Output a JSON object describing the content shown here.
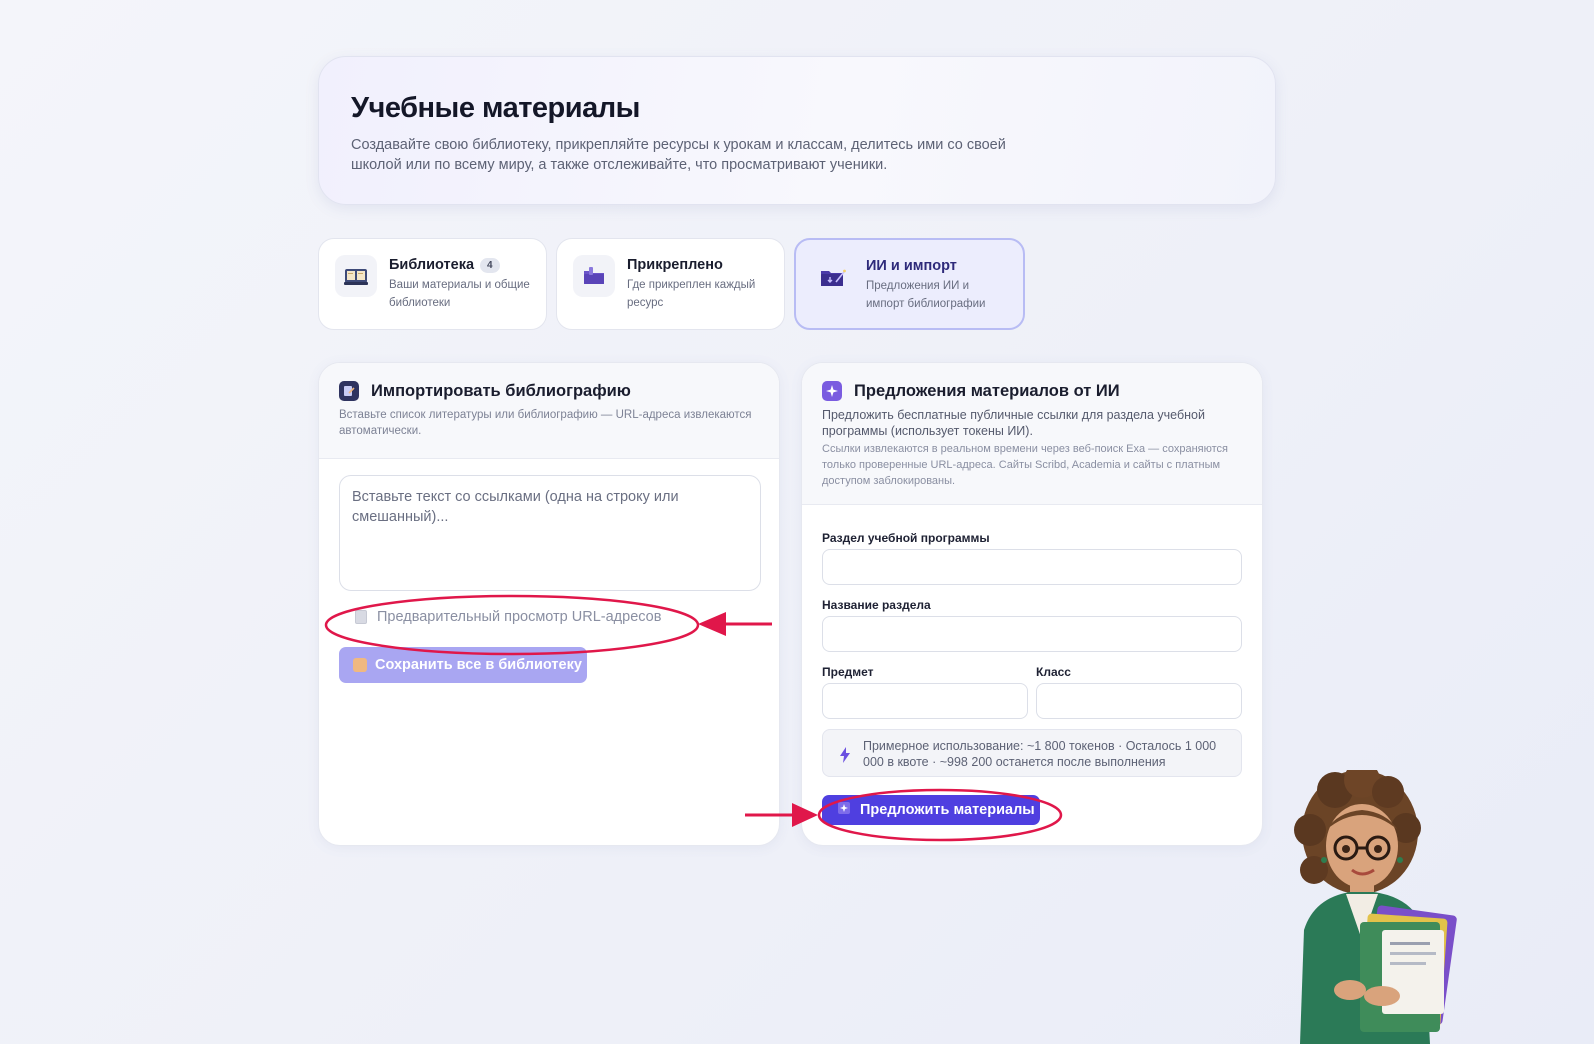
{
  "header": {
    "title": "Учебные материалы",
    "subtitle": "Создавайте свою библиотеку, прикрепляйте ресурсы к урокам и классам, делитесь ими со своей школой или по всему миру, а также отслеживайте, что просматривают ученики."
  },
  "tabs": [
    {
      "title": "Библиотека",
      "badge": "4",
      "subtitle": "Ваши материалы и общие библиотеки",
      "icon": "books-icon"
    },
    {
      "title": "Прикреплено",
      "subtitle": "Где прикреплен каждый ресурс",
      "icon": "folder-icon"
    },
    {
      "title": "ИИ и импорт",
      "subtitle": "Предложения ИИ и импорт библиографии",
      "icon": "magic-folder-icon",
      "active": true
    }
  ],
  "import_card": {
    "title": "Импортировать библиографию",
    "description": "Вставьте список литературы или библиографию — URL-адреса извлекаются автоматически.",
    "textarea_placeholder": "Вставьте текст со ссылками (одна на строку или смешанный)...",
    "preview_label": "Предварительный просмотр URL-адресов",
    "save_label": "Сохранить все в библиотеку"
  },
  "ai_card": {
    "title": "Предложения материалов от ИИ",
    "description": "Предложить бесплатные публичные ссылки для раздела учебной программы (использует токены ИИ).",
    "note": "Ссылки извлекаются в реальном времени через веб-поиск Exa — сохраняются только проверенные URL-адреса. Сайты Scribd, Academia и сайты с платным доступом заблокированы.",
    "fields": {
      "section_label": "Раздел учебной программы",
      "section_name_label": "Название раздела",
      "subject_label": "Предмет",
      "grade_label": "Класс"
    },
    "usage_text": "Примерное использование: ~1 800 токенов · Осталось 1 000 000 в квоте · ~998 200 останется после выполнения",
    "suggest_label": "Предложить материалы"
  },
  "colors": {
    "accent": "#4f3fe0",
    "accent_light": "#a9a6f2",
    "annotation": "#e0174a"
  }
}
